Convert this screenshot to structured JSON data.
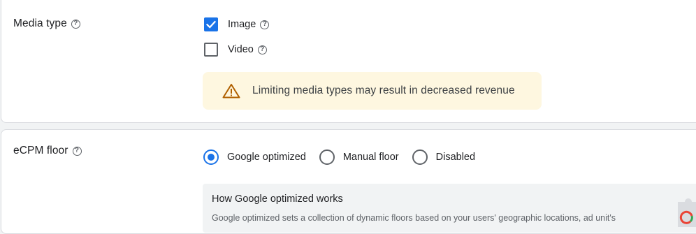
{
  "media_type": {
    "label": "Media type",
    "help_glyph": "?",
    "options": [
      {
        "label": "Image",
        "checked": true
      },
      {
        "label": "Video",
        "checked": false
      }
    ],
    "warning": {
      "icon": "warning-triangle-icon",
      "text": "Limiting media types may result in decreased revenue",
      "background": "#fef7e0",
      "icon_color": "#b06000"
    }
  },
  "ecpm_floor": {
    "label": "eCPM floor",
    "help_glyph": "?",
    "options": [
      {
        "label": "Google optimized",
        "selected": true
      },
      {
        "label": "Manual floor",
        "selected": false
      },
      {
        "label": "Disabled",
        "selected": false
      }
    ],
    "info": {
      "title": "How Google optimized works",
      "body": "Google optimized sets a collection of dynamic floors based on your users' geographic locations, ad unit's"
    }
  },
  "colors": {
    "accent": "#1a73e8",
    "border": "#dadce0",
    "text": "#202124",
    "muted": "#5f6368"
  }
}
